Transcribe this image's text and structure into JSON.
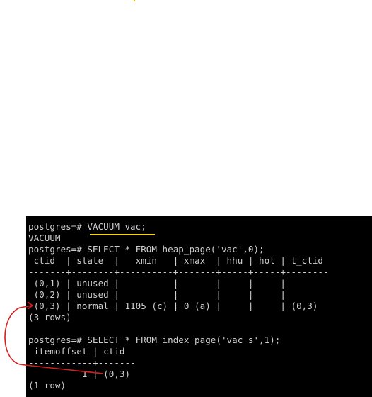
{
  "terminal": {
    "lines": [
      "postgres=# VACUUM vac;",
      "VACUUM",
      "postgres=# SELECT * FROM heap_page('vac',0);",
      " ctid  | state  |   xmin   | xmax  | hhu | hot | t_ctid",
      "-------+--------+----------+-------+-----+-----+--------",
      " (0,1) | unused |          |       |     |     |",
      " (0,2) | unused |          |       |     |     |",
      " (0,3) | normal | 1105 (c) | 0 (a) |     |     | (0,3)",
      "(3 rows)",
      "",
      "postgres=# SELECT * FROM index_page('vac_s',1);",
      " itemoffset | ctid",
      "------------+-------",
      "          1 | (0,3)",
      "(1 row)"
    ]
  },
  "colors": {
    "terminal_background": "#000000",
    "terminal_text": "#cfcfcf",
    "highlight_underline": "#f2d21b",
    "annotation_arrow": "#d62020"
  }
}
